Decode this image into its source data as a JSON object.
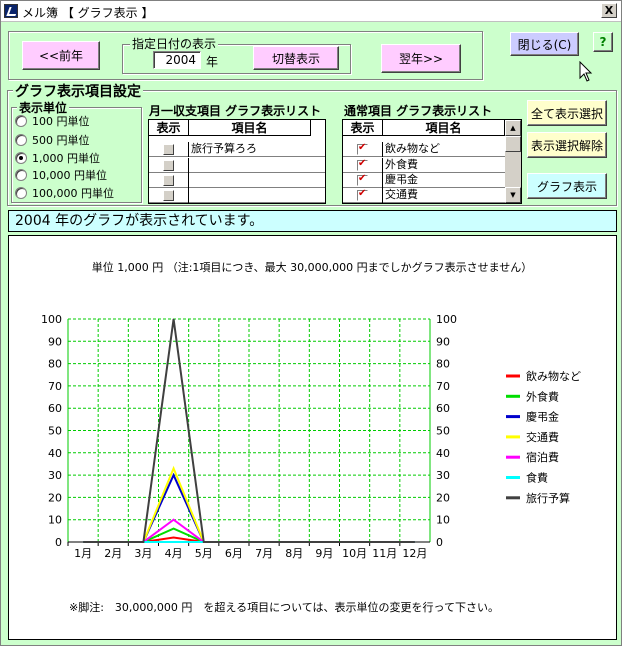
{
  "window": {
    "title": "メル簿 【 グラフ表示 】",
    "close_glyph": "X"
  },
  "nav": {
    "prev_label": "<<前年",
    "date_group_label": "指定日付の表示",
    "year_value": "2004",
    "year_unit": "年",
    "switch_label": "切替表示",
    "next_label": "翌年>>",
    "close_label": "閉じる(C)",
    "help_label": "?"
  },
  "settings": {
    "group_label": "グラフ表示項目設定",
    "unit_label": "表示単位",
    "units": [
      {
        "label": "100 円単位",
        "selected": false
      },
      {
        "label": "500 円単位",
        "selected": false
      },
      {
        "label": "1,000 円単位",
        "selected": true
      },
      {
        "label": "10,000 円単位",
        "selected": false
      },
      {
        "label": "100,000 円単位",
        "selected": false
      }
    ],
    "monthly_list_title": "月一収支項目 グラフ表示リスト",
    "common_list_title": "通常項目 グラフ表示リスト",
    "col_show": "表示",
    "col_name": "項目名",
    "monthly_items": [
      "旅行予算ろろ",
      "",
      "",
      ""
    ],
    "common_items": [
      "飲み物など",
      "外食費",
      "慶弔金",
      "交通費"
    ],
    "select_all_label": "全て表示選択",
    "deselect_label": "表示選択解除",
    "graph_label": "グラフ表示"
  },
  "status_text": "2004 年のグラフが表示されています。",
  "chart_data": {
    "type": "line",
    "title": "単位 1,000 円 （注:1項目につき、最大 30,000,000 円までしかグラフ表示させません）",
    "categories": [
      "1月",
      "2月",
      "3月",
      "4月",
      "5月",
      "6月",
      "7月",
      "8月",
      "9月",
      "10月",
      "11月",
      "12月"
    ],
    "ylim": [
      0,
      100
    ],
    "yticks": [
      0,
      10,
      20,
      30,
      40,
      50,
      60,
      70,
      80,
      90,
      100
    ],
    "grid": true,
    "legend_position": "right",
    "series": [
      {
        "name": "飲み物など",
        "color": "#ff0000",
        "values": [
          0,
          0,
          0,
          2,
          0,
          0,
          0,
          0,
          0,
          0,
          0,
          0
        ]
      },
      {
        "name": "外食費",
        "color": "#00dd00",
        "values": [
          0,
          0,
          0,
          6,
          0,
          0,
          0,
          0,
          0,
          0,
          0,
          0
        ]
      },
      {
        "name": "慶弔金",
        "color": "#0000cc",
        "values": [
          0,
          0,
          0,
          30,
          0,
          0,
          0,
          0,
          0,
          0,
          0,
          0
        ]
      },
      {
        "name": "交通費",
        "color": "#ffff00",
        "values": [
          0,
          0,
          0,
          33,
          0,
          0,
          0,
          0,
          0,
          0,
          0,
          0
        ]
      },
      {
        "name": "宿泊費",
        "color": "#ff00ff",
        "values": [
          0,
          0,
          0,
          10,
          0,
          0,
          0,
          0,
          0,
          0,
          0,
          0
        ]
      },
      {
        "name": "食費",
        "color": "#00ffff",
        "values": [
          0,
          0,
          0,
          0,
          0,
          0,
          0,
          0,
          0,
          0,
          0,
          0
        ]
      },
      {
        "name": "旅行予算",
        "color": "#404040",
        "values": [
          0,
          0,
          0,
          100,
          0,
          0,
          0,
          0,
          0,
          0,
          0,
          0
        ]
      }
    ],
    "footnote": "※脚注:　30,000,000 円　を超える項目については、表示単位の変更を行って下さい。"
  }
}
